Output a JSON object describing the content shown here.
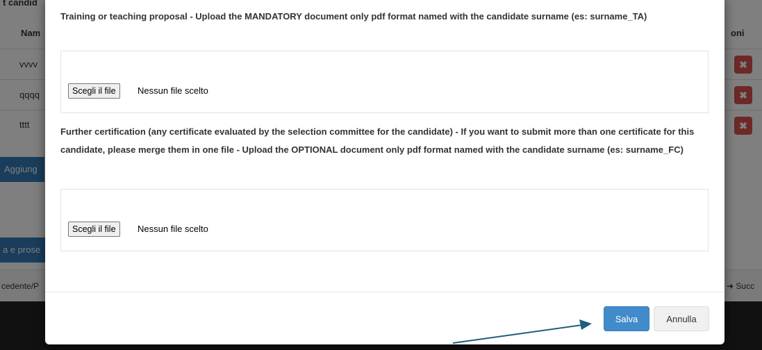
{
  "background": {
    "section_title": "t candid",
    "col_name": "Nam",
    "col_actions": "oni",
    "rows": [
      "vvvv",
      "qqqq",
      "tttt"
    ],
    "delete_glyph": "✖",
    "add_button": "Aggiung",
    "save_continue_button": "a e prose",
    "pager_prev": "cedente/P",
    "pager_next": "➜ Succ"
  },
  "modal": {
    "training_label": "Training or teaching proposal - Upload the MANDATORY document only pdf format named with the candidate surname (es: surname_TA)",
    "training_file_button": "Scegli il file",
    "training_file_status": "Nessun file scelto",
    "cert_label": "Further certification (any certificate evaluated by the selection committee for the candidate) - If you want to submit more than one certificate for this candidate, please merge them in one file - Upload the OPTIONAL document only pdf format named with the candidate surname (es: surname_FC)",
    "cert_file_button": "Scegli il file",
    "cert_file_status": "Nessun file scelto",
    "save_button": "Salva",
    "cancel_button": "Annulla"
  },
  "colors": {
    "primary": "#428bca",
    "danger": "#d9534f",
    "arrow": "#1f5f7a"
  }
}
